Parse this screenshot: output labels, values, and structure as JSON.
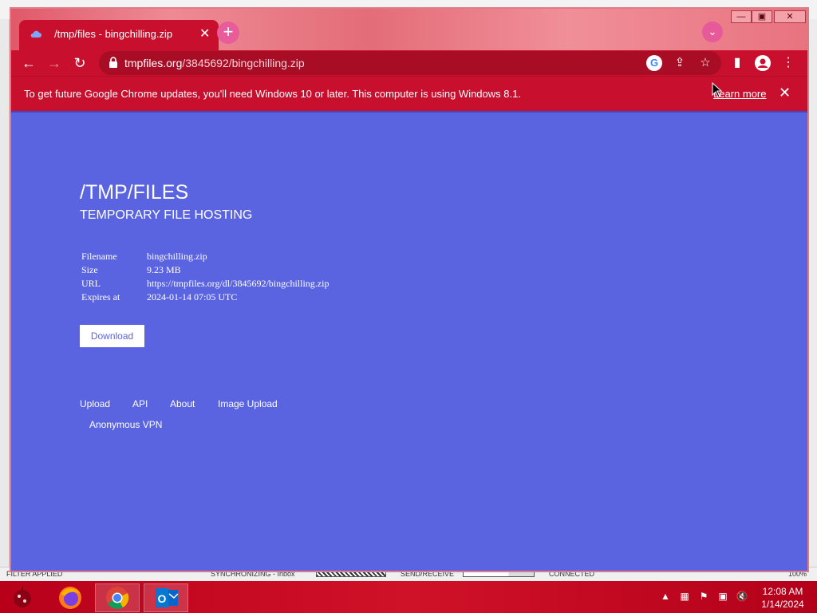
{
  "browser": {
    "tab_title": "/tmp/files - bingchilling.zip",
    "tab_close": "✕",
    "new_tab": "+",
    "url_host": "tmpfiles.org",
    "url_path": "/3845692/bingchilling.zip"
  },
  "infobar": {
    "message": "To get future Google Chrome updates, you'll need Windows 10 or later. This computer is using Windows 8.1.",
    "link": "Learn more",
    "close": "✕"
  },
  "page": {
    "title": "/TMP/FILES",
    "subtitle": "TEMPORARY FILE HOSTING",
    "details": [
      {
        "key": "Filename",
        "value": "bingchilling.zip"
      },
      {
        "key": "Size",
        "value": "9.23 MB"
      },
      {
        "key": "URL",
        "value": "https://tmpfiles.org/dl/3845692/bingchilling.zip"
      },
      {
        "key": "Expires at",
        "value": "2024-01-14 07:05 UTC"
      }
    ],
    "download_label": "Download",
    "footer_links": [
      "Upload",
      "API",
      "About",
      "Image Upload",
      "Anonymous VPN"
    ]
  },
  "background_status": {
    "filter": "FILTER APPLIED",
    "sync": "SYNCHRONIZING - Inbox",
    "send": "SEND/RECEIVE",
    "connected": "CONNECTED",
    "zoom": "100%"
  },
  "taskbar": {
    "time": "12:08 AM",
    "date": "1/14/2024"
  },
  "colors": {
    "page_background": "#5a64e0",
    "chrome_theme": "#c8102e"
  }
}
